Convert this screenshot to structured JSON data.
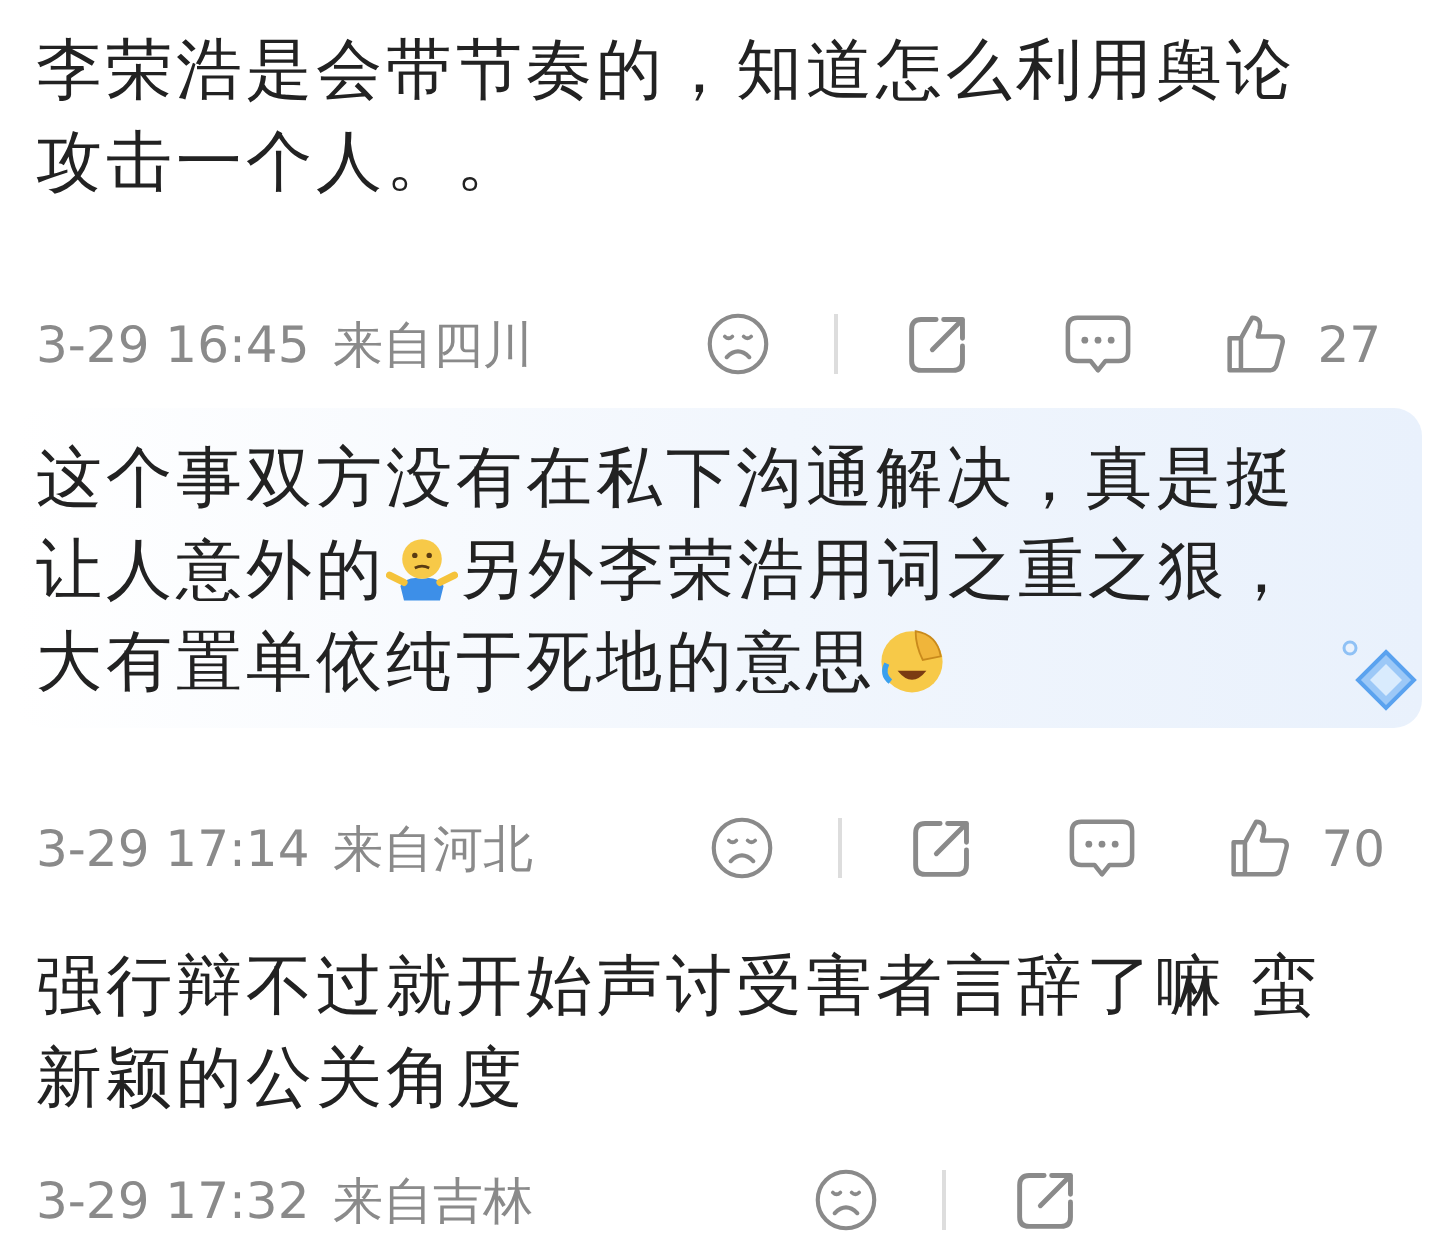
{
  "comments": [
    {
      "highlighted": false,
      "lines": [
        [
          {
            "kind": "text",
            "text": "李荣浩是会带节奏的，知道怎么利用舆论"
          }
        ],
        [
          {
            "kind": "text",
            "text": "攻击一个人。。"
          }
        ]
      ],
      "time": "3-29 16:45",
      "location": "来自四川",
      "actions": [
        {
          "kind": "dislike"
        },
        {
          "kind": "divider"
        },
        {
          "kind": "share"
        },
        {
          "kind": "comment"
        },
        {
          "kind": "like",
          "count": "27"
        }
      ]
    },
    {
      "highlighted": true,
      "lines": [
        [
          {
            "kind": "text",
            "text": "这个事双方没有在私下沟通解决，真是挺"
          }
        ],
        [
          {
            "kind": "text",
            "text": "让人意外的"
          },
          {
            "kind": "shrug"
          },
          {
            "kind": "text",
            "text": "另外李荣浩用词之重之狠，"
          }
        ],
        [
          {
            "kind": "text",
            "text": "大有置单依纯于死地的意思"
          },
          {
            "kind": "facepalm"
          }
        ]
      ],
      "time": "3-29 17:14",
      "location": "来自河北",
      "actions": [
        {
          "kind": "dislike"
        },
        {
          "kind": "divider"
        },
        {
          "kind": "share"
        },
        {
          "kind": "comment"
        },
        {
          "kind": "like",
          "count": "70"
        }
      ]
    },
    {
      "highlighted": false,
      "lines": [
        [
          {
            "kind": "text",
            "text": "强行辩不过就开始声讨受害者言辞了嘛 蛮"
          }
        ],
        [
          {
            "kind": "text",
            "text": "新颖的公关角度"
          }
        ]
      ],
      "time": "3-29 17:32",
      "location": "来自吉林",
      "actions": [
        {
          "kind": "dislike"
        },
        {
          "kind": "divider"
        },
        {
          "kind": "share"
        }
      ]
    }
  ]
}
